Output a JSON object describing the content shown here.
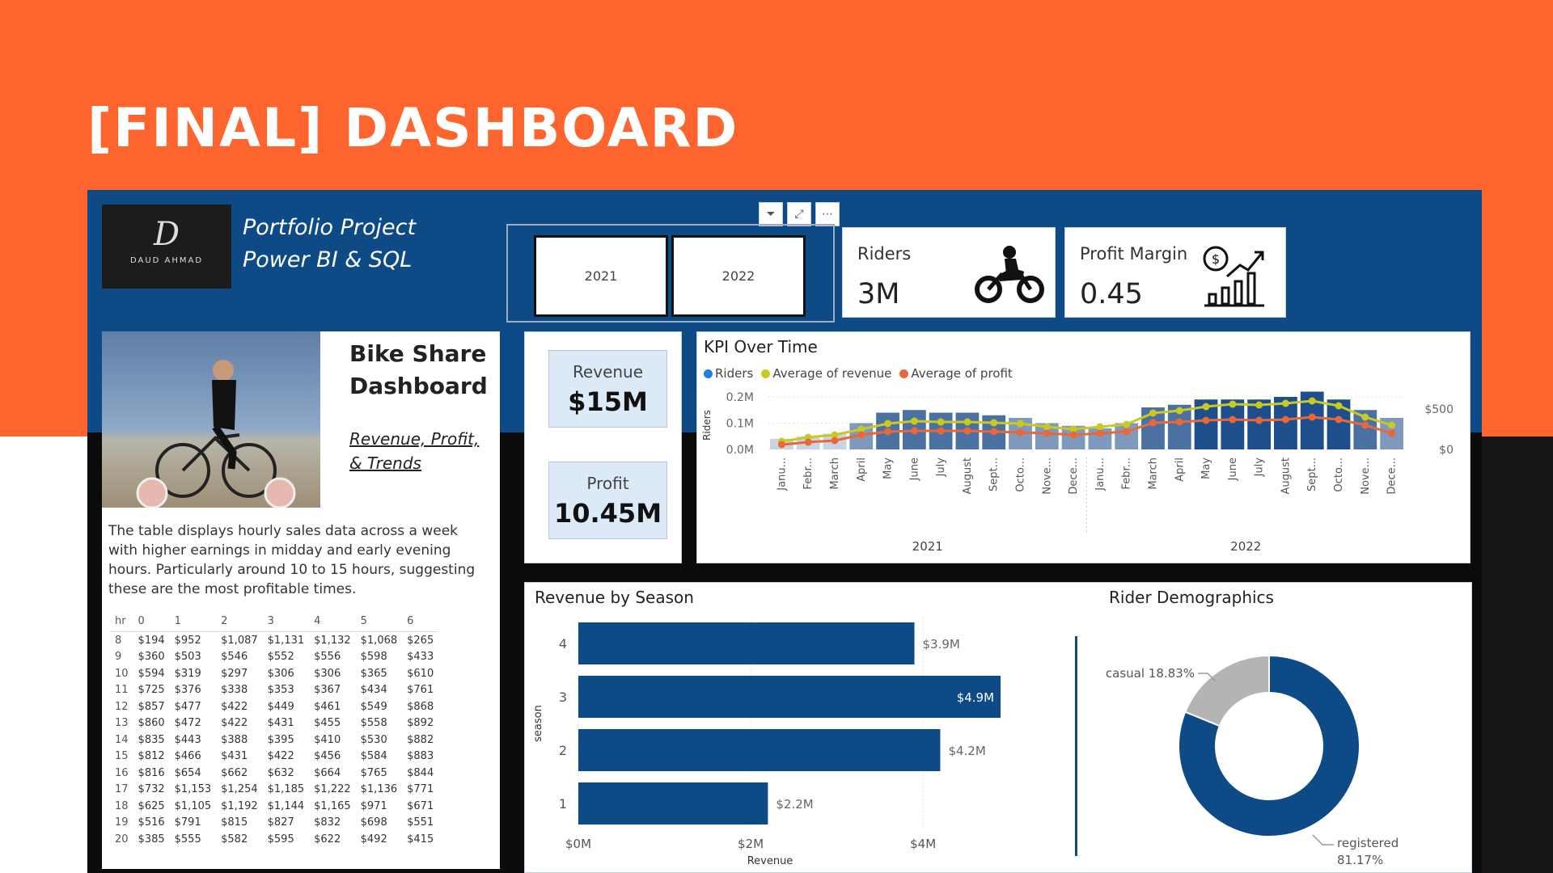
{
  "slide": {
    "title": "[FINAL] DASHBOARD"
  },
  "header": {
    "logo_initial": "D",
    "logo_name": "DAUD AHMAD",
    "line1": "Portfolio Project",
    "line2": "Power BI & SQL"
  },
  "slicer": {
    "options": [
      "2021",
      "2022"
    ],
    "tools": [
      "filter-icon",
      "focus-mode-icon",
      "more-options-icon"
    ]
  },
  "cards": {
    "riders": {
      "label": "Riders",
      "value": "3M",
      "icon": "motorcycle-icon"
    },
    "profit_margin": {
      "label": "Profit Margin",
      "value": "0.45",
      "icon": "growth-chart-icon"
    }
  },
  "intro": {
    "title": "Bike Share Dashboard",
    "subtitle": "Revenue, Profit, & Trends",
    "description": "The table displays hourly sales data across a week with higher earnings in midday and early evening hours. Particularly around 10 to 15 hours, suggesting these are the most profitable times.",
    "table": {
      "columns": [
        "hr",
        "0",
        "1",
        "2",
        "3",
        "4",
        "5",
        "6"
      ],
      "rows": [
        [
          "8",
          "$194",
          "$952",
          "$1,087",
          "$1,131",
          "$1,132",
          "$1,068",
          "$265"
        ],
        [
          "9",
          "$360",
          "$503",
          "$546",
          "$552",
          "$556",
          "$598",
          "$433"
        ],
        [
          "10",
          "$594",
          "$319",
          "$297",
          "$306",
          "$306",
          "$365",
          "$610"
        ],
        [
          "11",
          "$725",
          "$376",
          "$338",
          "$353",
          "$367",
          "$434",
          "$761"
        ],
        [
          "12",
          "$857",
          "$477",
          "$422",
          "$449",
          "$461",
          "$549",
          "$868"
        ],
        [
          "13",
          "$860",
          "$472",
          "$422",
          "$431",
          "$455",
          "$558",
          "$892"
        ],
        [
          "14",
          "$835",
          "$443",
          "$388",
          "$395",
          "$410",
          "$530",
          "$882"
        ],
        [
          "15",
          "$812",
          "$466",
          "$431",
          "$422",
          "$456",
          "$584",
          "$883"
        ],
        [
          "16",
          "$816",
          "$654",
          "$662",
          "$632",
          "$664",
          "$765",
          "$844"
        ],
        [
          "17",
          "$732",
          "$1,153",
          "$1,254",
          "$1,185",
          "$1,222",
          "$1,136",
          "$771"
        ],
        [
          "18",
          "$625",
          "$1,105",
          "$1,192",
          "$1,144",
          "$1,165",
          "$971",
          "$671"
        ],
        [
          "19",
          "$516",
          "$791",
          "$815",
          "$827",
          "$832",
          "$698",
          "$551"
        ],
        [
          "20",
          "$385",
          "$555",
          "$582",
          "$595",
          "$622",
          "$492",
          "$415"
        ]
      ]
    }
  },
  "kpi_mini": {
    "revenue": {
      "label": "Revenue",
      "value": "$15M"
    },
    "profit": {
      "label": "Profit",
      "value": "10.45M"
    }
  },
  "chart_data": [
    {
      "type": "bar+line",
      "title": "KPI Over Time",
      "legend": [
        "Riders",
        "Average of revenue",
        "Average of profit"
      ],
      "ylabel": "Riders",
      "y_ticks": [
        "0.0M",
        "0.1M",
        "0.2M"
      ],
      "y2_ticks": [
        "$0",
        "$500"
      ],
      "x_groups": [
        "2021",
        "2022"
      ],
      "categories": [
        "Janu...",
        "Febr...",
        "March",
        "April",
        "May",
        "June",
        "July",
        "August",
        "Sept...",
        "Octo...",
        "Nove...",
        "Dece...",
        "Janu...",
        "Febr...",
        "March",
        "April",
        "May",
        "June",
        "July",
        "August",
        "Sept...",
        "Octo...",
        "Nove...",
        "Dece..."
      ],
      "riders_m": [
        0.04,
        0.05,
        0.06,
        0.1,
        0.14,
        0.15,
        0.14,
        0.14,
        0.13,
        0.12,
        0.1,
        0.09,
        0.08,
        0.1,
        0.16,
        0.17,
        0.19,
        0.19,
        0.19,
        0.2,
        0.22,
        0.19,
        0.15,
        0.12
      ],
      "avg_revenue": [
        100,
        150,
        180,
        250,
        320,
        350,
        340,
        340,
        330,
        320,
        280,
        250,
        280,
        310,
        450,
        480,
        530,
        560,
        550,
        570,
        600,
        540,
        400,
        300
      ],
      "avg_profit": [
        60,
        90,
        110,
        180,
        220,
        230,
        230,
        230,
        220,
        210,
        200,
        180,
        200,
        220,
        330,
        340,
        360,
        370,
        360,
        370,
        400,
        370,
        300,
        200
      ],
      "colors": {
        "riders": "#1f4e8c",
        "revenue": "#c9c925",
        "profit": "#e8683a"
      }
    },
    {
      "type": "bar",
      "orientation": "horizontal",
      "title": "Revenue by Season",
      "ylabel": "season",
      "xlabel": "Revenue",
      "x_ticks": [
        "$0M",
        "$2M",
        "$4M"
      ],
      "categories": [
        "4",
        "3",
        "2",
        "1"
      ],
      "values": [
        3.9,
        4.9,
        4.2,
        2.2
      ],
      "labels": [
        "$3.9M",
        "$4.9M",
        "$4.2M",
        "$2.2M"
      ],
      "xlim": [
        0,
        5.2
      ]
    },
    {
      "type": "pie",
      "title": "Rider Demographics",
      "categories": [
        "registered",
        "casual"
      ],
      "values": [
        81.17,
        18.83
      ],
      "labels": [
        "registered 81.17%",
        "casual 18.83%"
      ],
      "colors": [
        "#0e4a86",
        "#b4b4b4"
      ]
    }
  ]
}
